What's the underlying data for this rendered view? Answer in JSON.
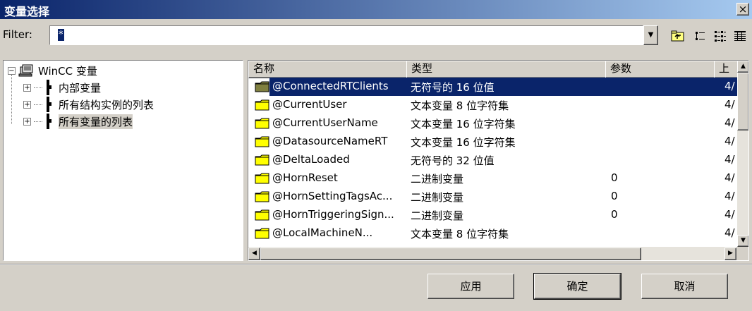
{
  "window": {
    "title": "变量选择",
    "close_label": "×"
  },
  "filter": {
    "label": "Filter:",
    "value": "*"
  },
  "toolbar": {
    "icons": [
      "up-folder-icon",
      "list-view-icon",
      "small-icons-view-icon",
      "details-view-icon"
    ]
  },
  "tree": {
    "root": {
      "label": "WinCC 变量",
      "expander": "−"
    },
    "items": [
      {
        "label": "内部变量",
        "expander": "+"
      },
      {
        "label": "所有结构实例的列表",
        "expander": "+"
      },
      {
        "label": "所有变量的列表",
        "expander": "+",
        "selected": true
      }
    ]
  },
  "list": {
    "columns": [
      "名称",
      "类型",
      "参数",
      "上"
    ],
    "rows": [
      {
        "name": "@ConnectedRTClients",
        "type": "无符号的 16 位值",
        "param": "",
        "updated": "4/",
        "selected": true
      },
      {
        "name": "@CurrentUser",
        "type": "文本变量 8 位字符集",
        "param": "",
        "updated": "4/"
      },
      {
        "name": "@CurrentUserName",
        "type": "文本变量 16 位字符集",
        "param": "",
        "updated": "4/"
      },
      {
        "name": "@DatasourceNameRT",
        "type": "文本变量 16 位字符集",
        "param": "",
        "updated": "4/"
      },
      {
        "name": "@DeltaLoaded",
        "type": "无符号的 32 位值",
        "param": "",
        "updated": "4/"
      },
      {
        "name": "@HornReset",
        "type": "二进制变量",
        "param": "0",
        "updated": "4/"
      },
      {
        "name": "@HornSettingTagsAc...",
        "type": "二进制变量",
        "param": "0",
        "updated": "4/"
      },
      {
        "name": "@HornTriggeringSign...",
        "type": "二进制变量",
        "param": "0",
        "updated": "4/"
      },
      {
        "name": "@LocalMachineN...",
        "type": "文本变量 8 位字符集",
        "param": "",
        "updated": "4/"
      }
    ]
  },
  "buttons": {
    "apply": "应用",
    "ok": "确定",
    "cancel": "取消"
  }
}
